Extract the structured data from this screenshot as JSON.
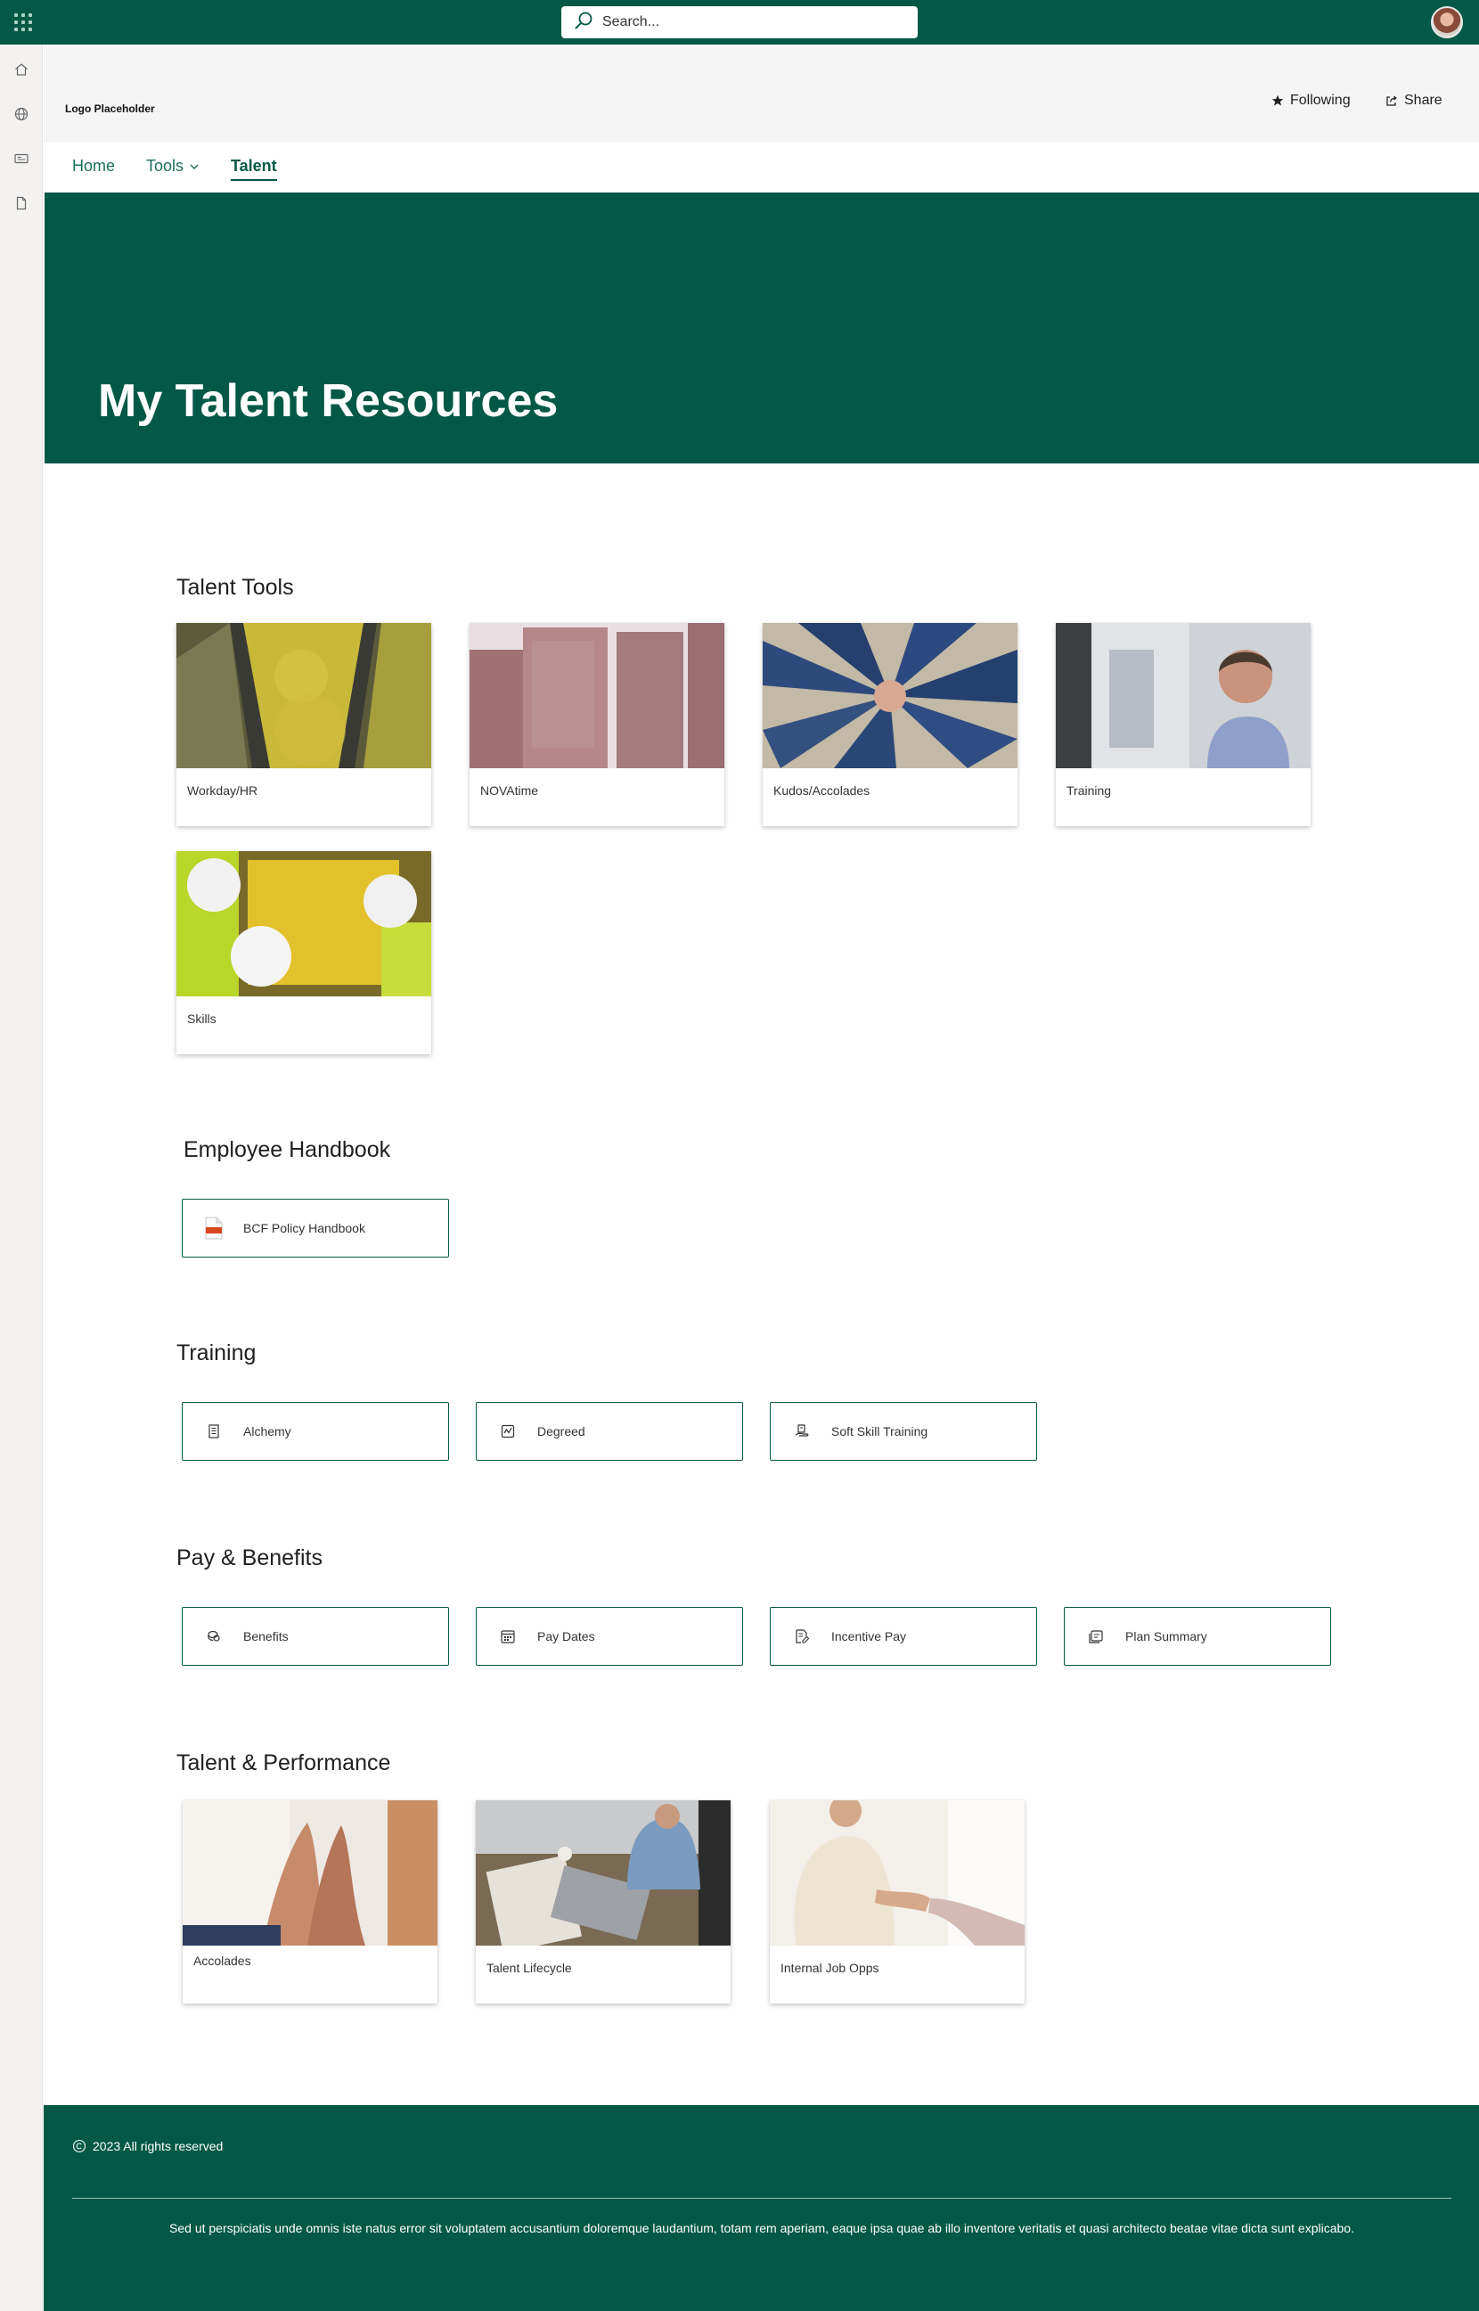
{
  "suite_bar": {
    "app_launcher_icon": "waffle-icon",
    "search_placeholder": "Search...",
    "avatar_icon": "user-avatar"
  },
  "left_rail": {
    "icons": [
      "home-icon",
      "globe-icon",
      "news-icon",
      "document-icon"
    ]
  },
  "header": {
    "logo": "Logo Placeholder",
    "following_label": "Following",
    "share_label": "Share"
  },
  "nav": {
    "items": [
      {
        "label": "Home"
      },
      {
        "label": "Tools"
      },
      {
        "label": "Talent"
      }
    ]
  },
  "hero": {
    "title": "My Talent Resources"
  },
  "talent_tools": {
    "title": "Talent Tools",
    "cards": [
      {
        "label": "Workday/HR"
      },
      {
        "label": "NOVAtime"
      },
      {
        "label": "Kudos/Accolades"
      },
      {
        "label": "Training"
      },
      {
        "label": "Skills"
      }
    ]
  },
  "handbook": {
    "title": "Employee Handbook",
    "link": {
      "label": "BCF Policy Handbook",
      "icon": "pdf-file-icon"
    }
  },
  "training": {
    "title": "Training",
    "links": [
      {
        "label": "Alchemy",
        "icon": "notebook-icon"
      },
      {
        "label": "Degreed",
        "icon": "activity-icon"
      },
      {
        "label": "Soft Skill Training",
        "icon": "hand-document-icon"
      }
    ]
  },
  "pay_benefits": {
    "title": "Pay & Benefits",
    "links": [
      {
        "label": "Benefits",
        "icon": "coins-icon"
      },
      {
        "label": "Pay Dates",
        "icon": "calendar-icon"
      },
      {
        "label": "Incentive Pay",
        "icon": "document-edit-icon"
      },
      {
        "label": "Plan Summary",
        "icon": "documents-icon"
      }
    ]
  },
  "talent_performance": {
    "title": "Talent & Performance",
    "cards": [
      {
        "label": "Accolades"
      },
      {
        "label": "Talent Lifecycle"
      },
      {
        "label": "Internal Job Opps"
      }
    ]
  },
  "footer": {
    "copyright": "2023 All rights reserved",
    "text": "Sed ut perspiciatis unde omnis iste natus error sit voluptatem accusantium doloremque laudantium, totam rem aperiam, eaque ipsa quae ab illo inventore veritatis et quasi architecto beatae vitae dicta sunt explicabo."
  },
  "colors": {
    "brand": "#035945",
    "nav_text": "#1b6e5a",
    "rail": "#f3f2f1"
  }
}
